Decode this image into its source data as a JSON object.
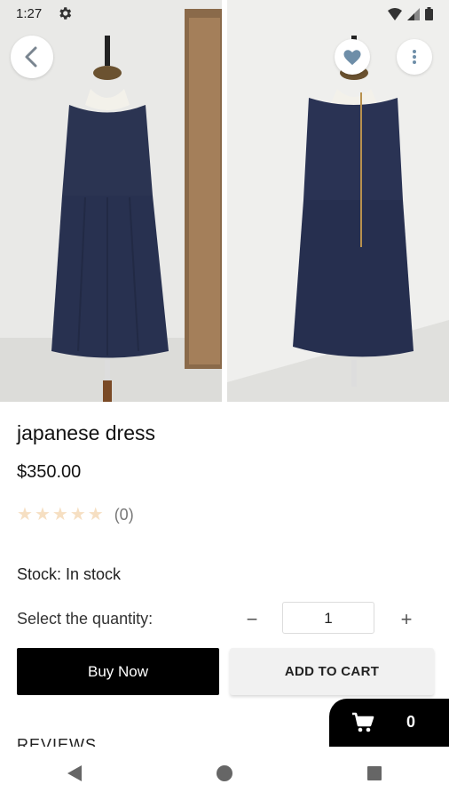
{
  "status_bar": {
    "time": "1:27"
  },
  "product": {
    "title": "japanese dress",
    "price": "$350.00",
    "rating_count": "(0)",
    "stock_text": "Stock: In stock",
    "quantity_label": "Select the quantity:",
    "quantity_value": "1",
    "rating_stars": 0
  },
  "buttons": {
    "buy_now": "Buy Now",
    "add_to_cart": "ADD TO CART",
    "minus": "−",
    "plus": "+"
  },
  "section": {
    "reviews": "REVIEWS"
  },
  "cart": {
    "count": "0"
  },
  "icons": {
    "back": "arrow-back-icon",
    "favorite": "heart-icon",
    "menu": "more-vertical-icon",
    "cart": "cart-icon",
    "settings": "gear-icon"
  },
  "colors": {
    "primary": "#000000",
    "star": "#f6dfc2",
    "favorite": "#6e8ea8"
  }
}
